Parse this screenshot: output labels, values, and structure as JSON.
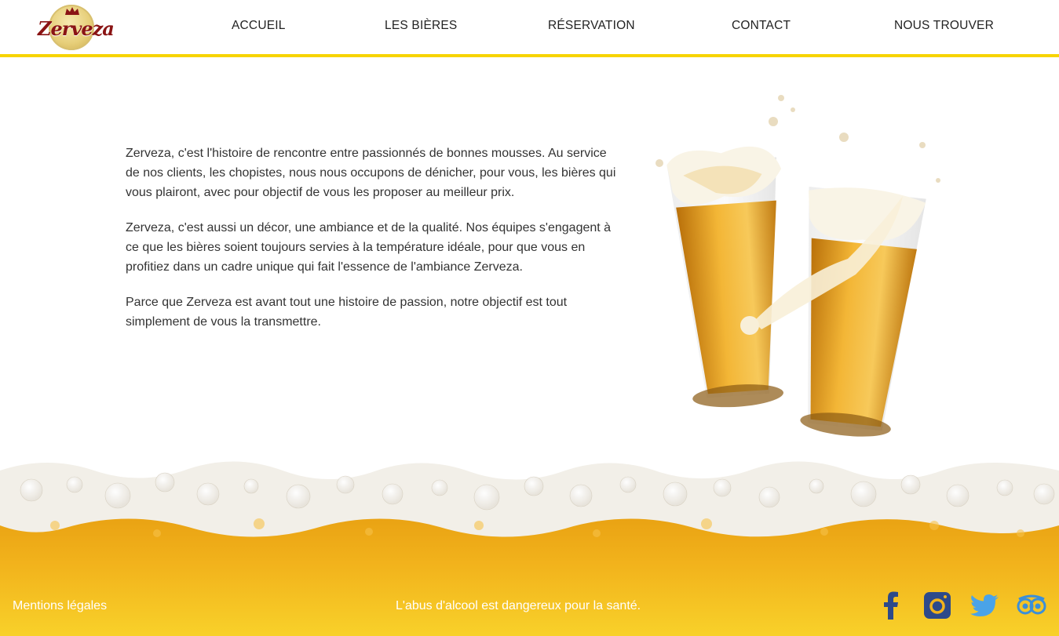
{
  "brand": {
    "logo_text": "Zerveza",
    "color": "#8a1414"
  },
  "nav": {
    "items": [
      {
        "label": "ACCUEIL"
      },
      {
        "label": "LES BIÈRES"
      },
      {
        "label": "RÉSERVATION"
      },
      {
        "label": "CONTACT"
      },
      {
        "label": "NOUS TROUVER"
      }
    ],
    "accent_color": "#f7d400"
  },
  "content": {
    "paragraphs": [
      "Zerveza, c'est l'histoire de rencontre entre passionnés de bonnes mousses. Au service de nos clients, les chopistes, nous nous occupons de dénicher, pour vous, les bières qui vous plairont, avec pour objectif de vous les proposer au meilleur prix.",
      "Zerveza, c'est aussi un décor, une ambiance et de la qualité. Nos équipes s'engagent à ce que les bières soient toujours servies à la température idéale, pour que vous en profitiez dans un cadre unique qui fait l'essence de l'ambiance Zerveza.",
      "Parce que Zerveza est avant tout une histoire de passion, notre objectif est tout simplement de vous la transmettre."
    ]
  },
  "footer": {
    "legal_label": "Mentions légales",
    "warning": "L'abus d'alcool est dangereux pour la santé.",
    "social": [
      {
        "icon": "facebook-icon",
        "color": "#2d4a8a"
      },
      {
        "icon": "instagram-icon",
        "color": "#2d4a8a"
      },
      {
        "icon": "twitter-icon",
        "color": "#4aa3e8"
      },
      {
        "icon": "tripadvisor-icon",
        "color": "#3b8fd8"
      }
    ]
  }
}
